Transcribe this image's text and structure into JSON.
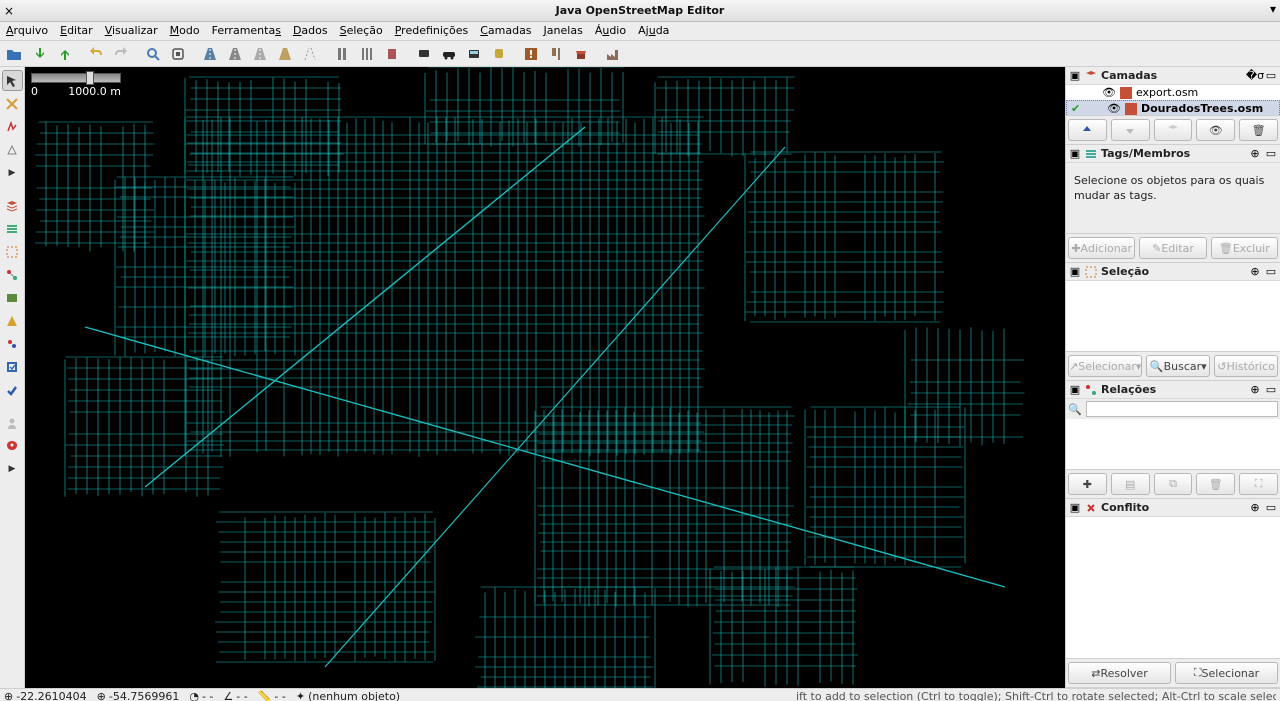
{
  "window": {
    "title": "Java OpenStreetMap Editor"
  },
  "menu": {
    "arquivo": "Arquivo",
    "editar": "Editar",
    "visualizar": "Visualizar",
    "modo": "Modo",
    "ferramentas": "Ferramentas",
    "dados": "Dados",
    "selecao": "Seleção",
    "predefinicoes": "Predefinições",
    "camadas": "Camadas",
    "janelas": "Janelas",
    "audio": "Áudio",
    "ajuda": "Ajuda"
  },
  "scale": {
    "zero": "0",
    "distance": "1000.0 m"
  },
  "panels": {
    "camadas": {
      "title": "Camadas",
      "layers": [
        {
          "name": "export.osm",
          "selected": false,
          "active": false
        },
        {
          "name": "DouradosTrees.osm",
          "selected": true,
          "active": true
        }
      ]
    },
    "tags": {
      "title": "Tags/Membros",
      "message": "Selecione os objetos para os quais mudar as tags.",
      "add": "Adicionar",
      "edit": "Editar",
      "del": "Excluir"
    },
    "selecao": {
      "title": "Seleção",
      "selecionar": "Selecionar",
      "buscar": "Buscar",
      "historico": "Histórico"
    },
    "relacoes": {
      "title": "Relações",
      "search_placeholder": ""
    },
    "conflito": {
      "title": "Conflito",
      "resolver": "Resolver",
      "selecionar": "Selecionar"
    }
  },
  "status": {
    "lat": "-22.2610404",
    "lon": "-54.7569961",
    "heading": "- -",
    "angle": "- -",
    "object": "(nenhum objeto)",
    "help": "ift to add to selection (Ctrl to toggle); Shift-Ctrl to rotate selected; Alt-Ctrl to scale selected; or change selection"
  },
  "icons": {
    "open": "open-icon",
    "download": "download-icon",
    "upload": "upload-icon",
    "undo": "undo-icon",
    "redo": "redo-icon",
    "search": "search-icon",
    "prefs": "prefs-icon",
    "road": "road-icon",
    "road2": "road2-icon",
    "road3": "road3-icon",
    "road4": "road4-icon",
    "barrier": "barrier-icon",
    "barrier2": "barrier2-icon",
    "barrier3": "barrier3-icon",
    "transport": "transport-icon",
    "car": "car-icon",
    "bus": "bus-icon",
    "train": "train-icon",
    "warning": "warning-icon",
    "food": "food-icon",
    "hotel": "hotel-icon",
    "factory": "factory-icon",
    "select": "select-icon",
    "lasso": "lasso-icon",
    "draw": "draw-icon",
    "node": "node-icon",
    "building": "building-icon",
    "expand": "expand-icon"
  }
}
